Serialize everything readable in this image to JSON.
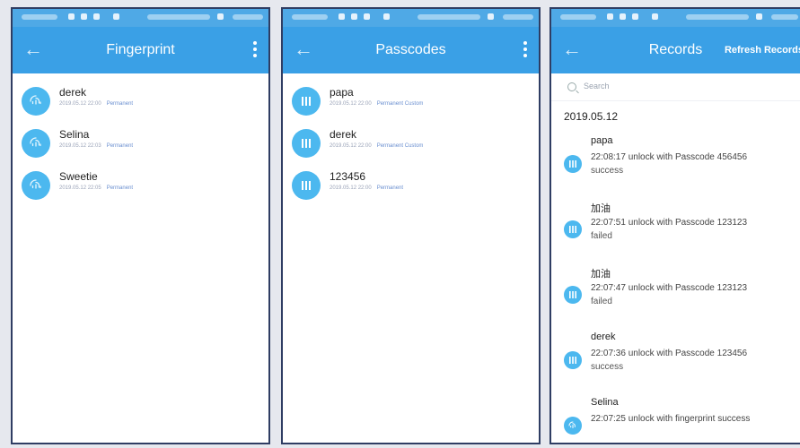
{
  "fingerprint": {
    "title": "Fingerprint",
    "items": [
      {
        "name": "derek",
        "date": "2019.05.12 22:00",
        "type": "Permanent"
      },
      {
        "name": "Selina",
        "date": "2019.05.12 22:03",
        "type": "Permanent"
      },
      {
        "name": "Sweetie",
        "date": "2019.05.12 22:05",
        "type": "Permanent"
      }
    ]
  },
  "passcodes": {
    "title": "Passcodes",
    "items": [
      {
        "name": "papa",
        "date": "2019.05.12 22:00",
        "type": "Permanent Custom"
      },
      {
        "name": "derek",
        "date": "2019.05.12 22:00",
        "type": "Permanent Custom"
      },
      {
        "name": "123456",
        "date": "2019.05.12 22:00",
        "type": "Permanent"
      }
    ]
  },
  "records": {
    "title": "Records",
    "refresh_label": "Refresh Records",
    "search_placeholder": "Search",
    "date": "2019.05.12",
    "items": [
      {
        "user": "papa",
        "detail": "22:08:17 unlock with Passcode 456456",
        "status": "success",
        "icon": "keypad-icon"
      },
      {
        "user": "加油",
        "detail": "22:07:51 unlock with Passcode 123123",
        "status": "failed",
        "icon": "keypad-icon"
      },
      {
        "user": "加油",
        "detail": "22:07:47 unlock with Passcode 123123",
        "status": "failed",
        "icon": "keypad-icon"
      },
      {
        "user": "derek",
        "detail": "22:07:36 unlock with Passcode 123456",
        "status": "success",
        "icon": "keypad-icon"
      },
      {
        "user": "Selina",
        "detail": "22:07:25 unlock with fingerprint success",
        "status": "",
        "icon": "fingerprint-icon"
      }
    ]
  },
  "colors": {
    "header": "#3aa0e6",
    "avatar": "#4cb8ef",
    "frame": "#2f3d63",
    "tag": "#6a8fd0"
  }
}
